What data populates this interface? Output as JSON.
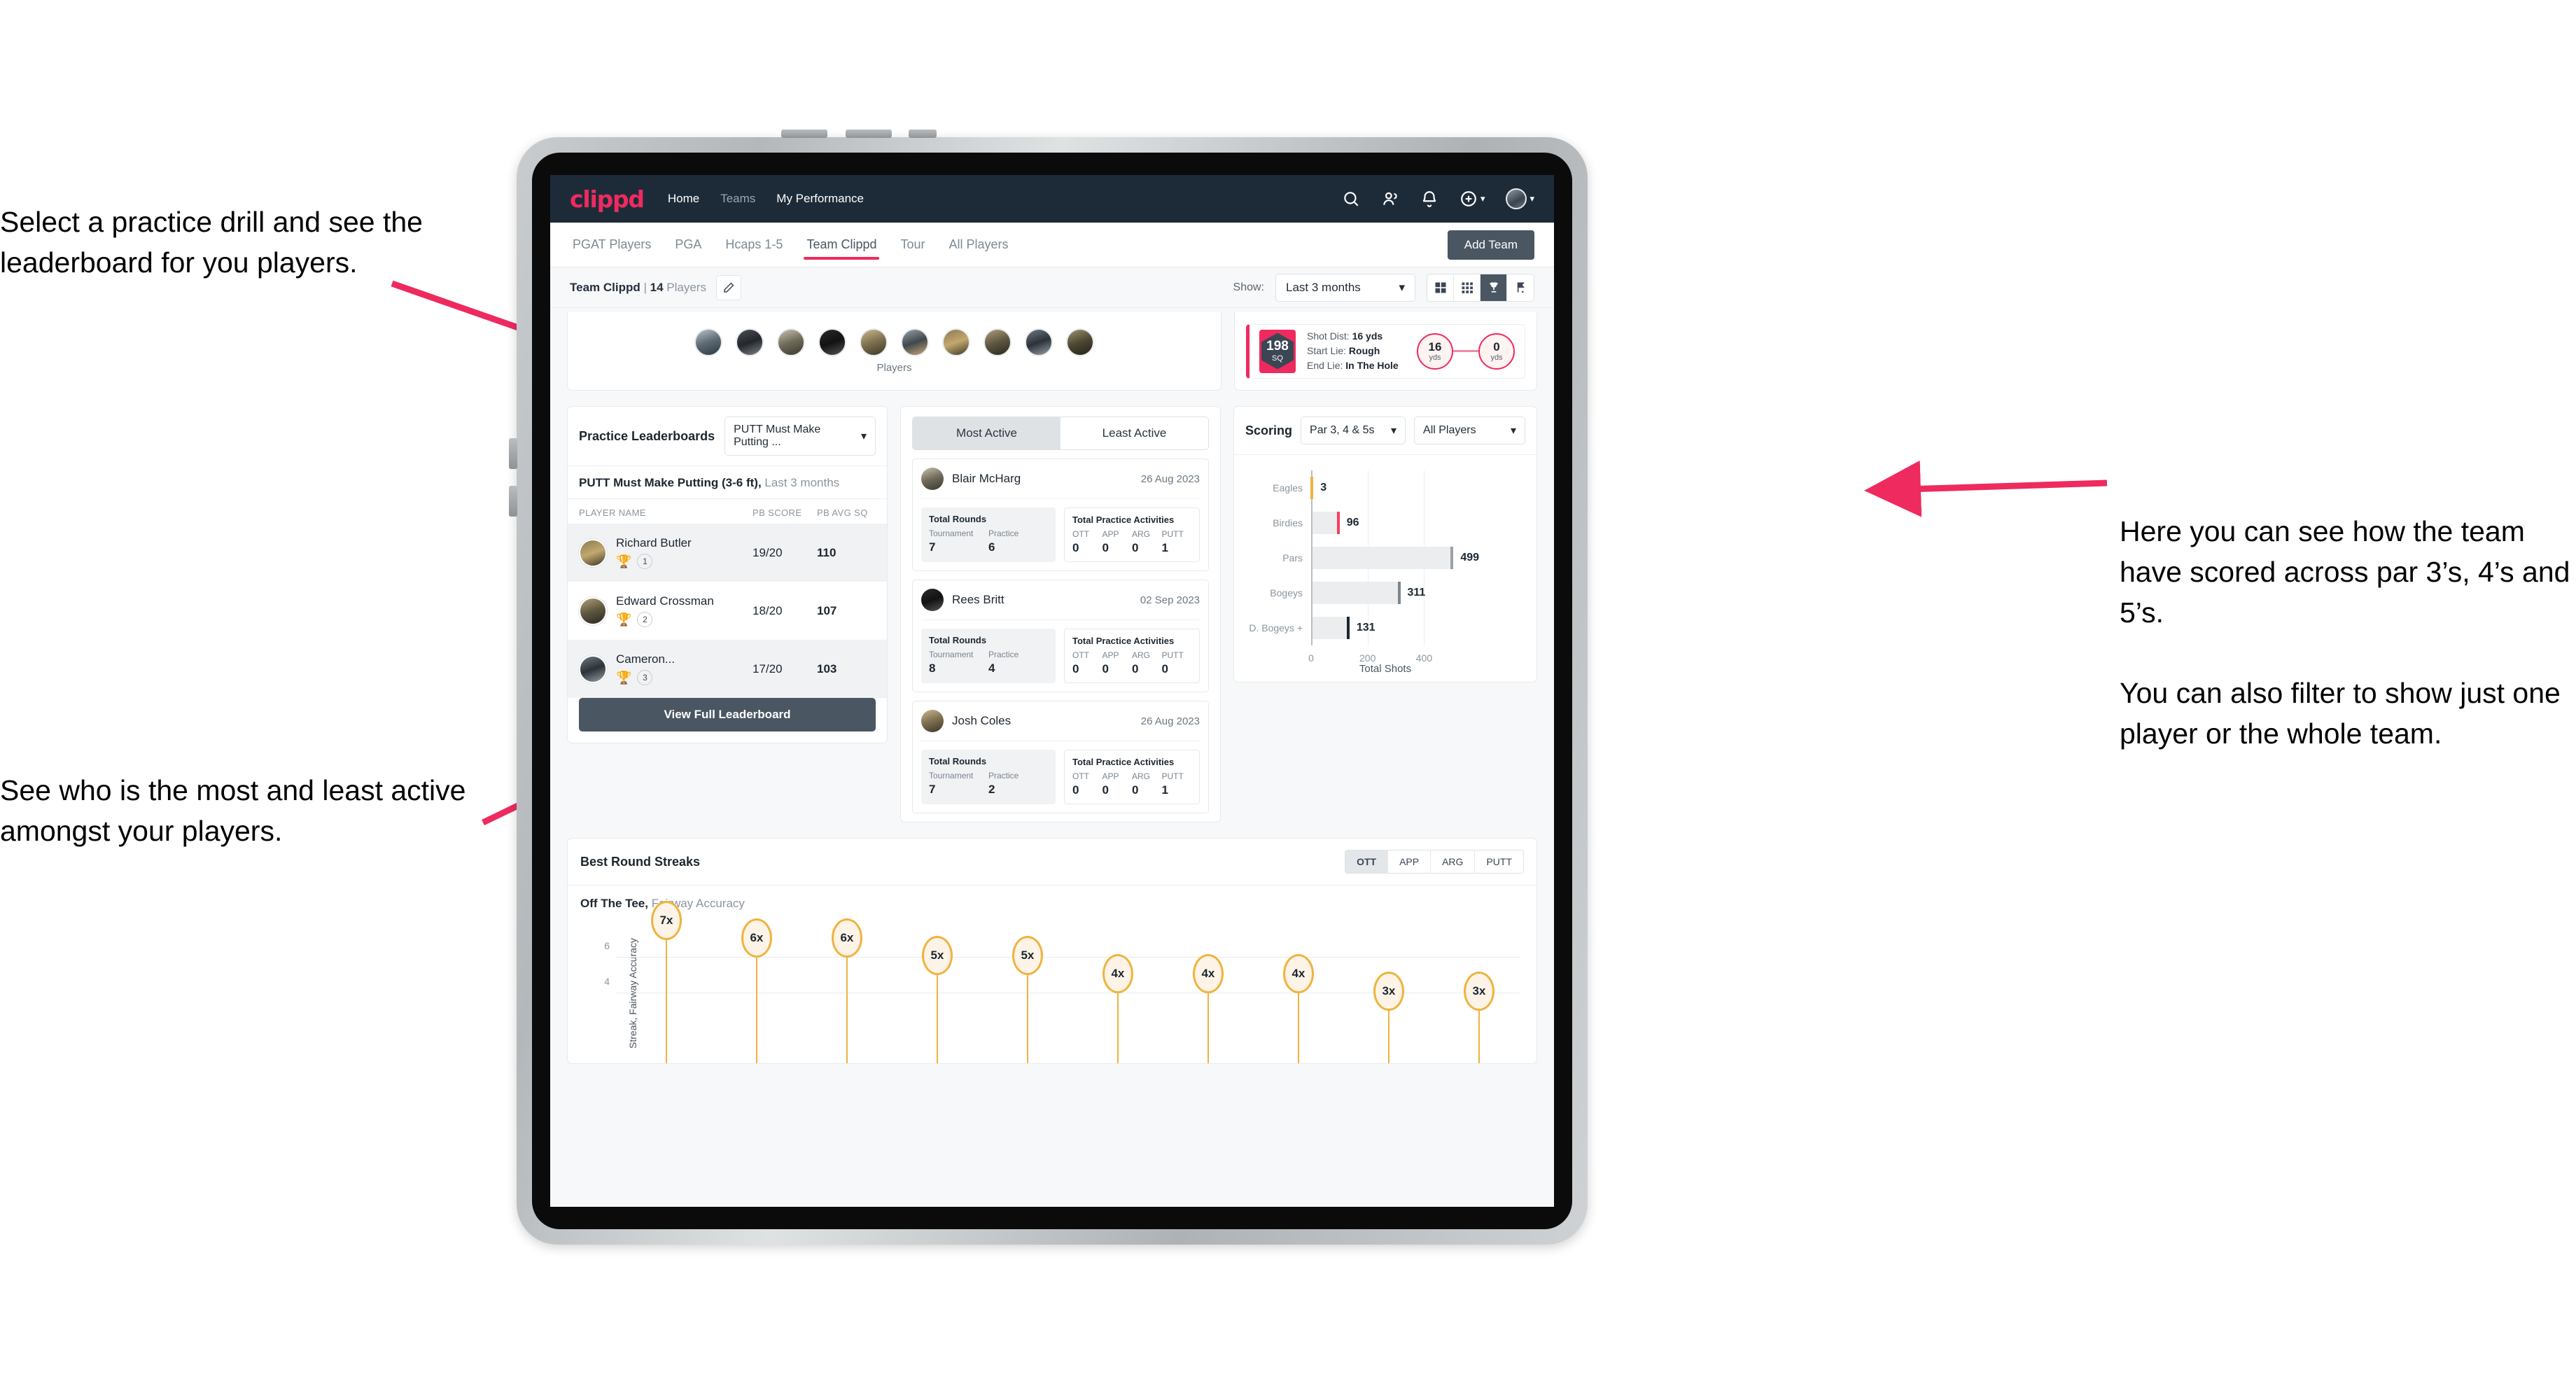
{
  "annotations": {
    "top_left": "Select a practice drill and see the leaderboard for you players.",
    "bottom_left": "See who is the most and least active amongst your players.",
    "right_1": "Here you can see how the team have scored across par 3’s, 4’s and 5’s.",
    "right_2": "You can also filter to show just one player or the whole team."
  },
  "colors": {
    "brand_pink": "#ee2a5f",
    "nav_dark": "#1d2b39",
    "button_slate": "#4a5662",
    "streak_gold": "#efb33f",
    "page_bg": "#f7f8fa"
  },
  "navbar": {
    "brand": "clippd",
    "links": [
      {
        "label": "Home",
        "active": true
      },
      {
        "label": "Teams",
        "active": false
      },
      {
        "label": "My Performance",
        "active": true
      }
    ],
    "icons": [
      "search-icon",
      "people-icon",
      "bell-icon",
      "plus-circle-icon",
      "avatar"
    ]
  },
  "tabs": {
    "items": [
      {
        "label": "PGAT Players",
        "active": false
      },
      {
        "label": "PGA",
        "active": false
      },
      {
        "label": "Hcaps 1-5",
        "active": false
      },
      {
        "label": "Team Clippd",
        "active": true
      },
      {
        "label": "Tour",
        "active": false
      },
      {
        "label": "All Players",
        "active": false
      }
    ],
    "add_team_label": "Add Team"
  },
  "team_row": {
    "team_name": "Team Clippd",
    "separator": " | ",
    "player_count": "14",
    "players_word": " Players",
    "show_label": "Show:",
    "show_value": "Last 3 months",
    "view_modes": [
      "grid-large-icon",
      "grid-small-icon",
      "trophy-icon",
      "golf-flag-icon"
    ],
    "active_view_index": 2
  },
  "players_strip": {
    "caption": "Players",
    "count": 10
  },
  "shot_card": {
    "sq_value": "198",
    "sq_unit": "SQ",
    "lines": [
      {
        "label": "Shot Dist:",
        "value": "16 yds"
      },
      {
        "label": "Start Lie:",
        "value": "Rough"
      },
      {
        "label": "End Lie:",
        "value": "In The Hole"
      }
    ],
    "start_dist": "16",
    "start_unit": "yds",
    "end_dist": "0",
    "end_unit": "yds"
  },
  "leaderboard": {
    "title": "Practice Leaderboards",
    "drill_select": "PUTT Must Make Putting ...",
    "subtitle_bold": "PUTT Must Make Putting (3-6 ft),",
    "subtitle_light": " Last 3 months",
    "columns": [
      "PLAYER NAME",
      "PB SCORE",
      "PB AVG SQ"
    ],
    "rows": [
      {
        "name": "Richard Butler",
        "rank": "1",
        "medal": "gold",
        "score": "19/20",
        "sq": "110"
      },
      {
        "name": "Edward Crossman",
        "rank": "2",
        "medal": "silver",
        "score": "18/20",
        "sq": "107"
      },
      {
        "name": "Cameron...",
        "rank": "3",
        "medal": "bronze",
        "score": "17/20",
        "sq": "103"
      }
    ],
    "view_full_label": "View Full Leaderboard"
  },
  "activity": {
    "toggle": [
      {
        "label": "Most Active",
        "active": true
      },
      {
        "label": "Least Active",
        "active": false
      }
    ],
    "rounds_title": "Total Rounds",
    "activities_title": "Total Practice Activities",
    "rounds_keys": [
      "Tournament",
      "Practice"
    ],
    "activity_keys": [
      "OTT",
      "APP",
      "ARG",
      "PUTT"
    ],
    "players": [
      {
        "name": "Blair McHarg",
        "date": "26 Aug 2023",
        "tournament": "7",
        "practice": "6",
        "ott": "0",
        "app": "0",
        "arg": "0",
        "putt": "1"
      },
      {
        "name": "Rees Britt",
        "date": "02 Sep 2023",
        "tournament": "8",
        "practice": "4",
        "ott": "0",
        "app": "0",
        "arg": "0",
        "putt": "0"
      },
      {
        "name": "Josh Coles",
        "date": "26 Aug 2023",
        "tournament": "7",
        "practice": "2",
        "ott": "0",
        "app": "0",
        "arg": "0",
        "putt": "1"
      }
    ]
  },
  "scoring": {
    "title": "Scoring",
    "par_select": "Par 3, 4 & 5s",
    "player_select": "All Players"
  },
  "streaks": {
    "title": "Best Round Streaks",
    "segments": [
      {
        "label": "OTT",
        "active": true
      },
      {
        "label": "APP",
        "active": false
      },
      {
        "label": "ARG",
        "active": false
      },
      {
        "label": "PUTT",
        "active": false
      }
    ],
    "sub_bold": "Off The Tee,",
    "sub_light": " Fairway Accuracy"
  },
  "chart_data": [
    {
      "type": "bar",
      "orientation": "horizontal",
      "title": "Scoring",
      "categories": [
        "Eagles",
        "Birdies",
        "Pars",
        "Bogeys",
        "D. Bogeys +"
      ],
      "values": [
        3,
        96,
        499,
        311,
        131
      ],
      "bar_cap_colors": [
        "#efb33f",
        "#f0415f",
        "#9aa1a8",
        "#7d858d",
        "#1d2630"
      ],
      "xlabel": "Total Shots",
      "ylabel": "",
      "xlim": [
        0,
        560
      ],
      "xticks": [
        0,
        200,
        400
      ],
      "grid": true,
      "legend": "none"
    },
    {
      "type": "scatter",
      "subtype": "lollipop",
      "title": "Best Round Streaks",
      "series_label": "Off The Tee, Fairway Accuracy",
      "ylabel": "Streak, Fairway Accuracy",
      "values": [
        7,
        6,
        6,
        5,
        5,
        4,
        4,
        4,
        3,
        3
      ],
      "point_labels": [
        "7x",
        "6x",
        "6x",
        "5x",
        "5x",
        "4x",
        "4x",
        "4x",
        "3x",
        "3x"
      ],
      "yticks": [
        4,
        6
      ],
      "ylim": [
        0,
        7.8
      ],
      "grid": true,
      "marker_color": "#efb33f"
    }
  ]
}
